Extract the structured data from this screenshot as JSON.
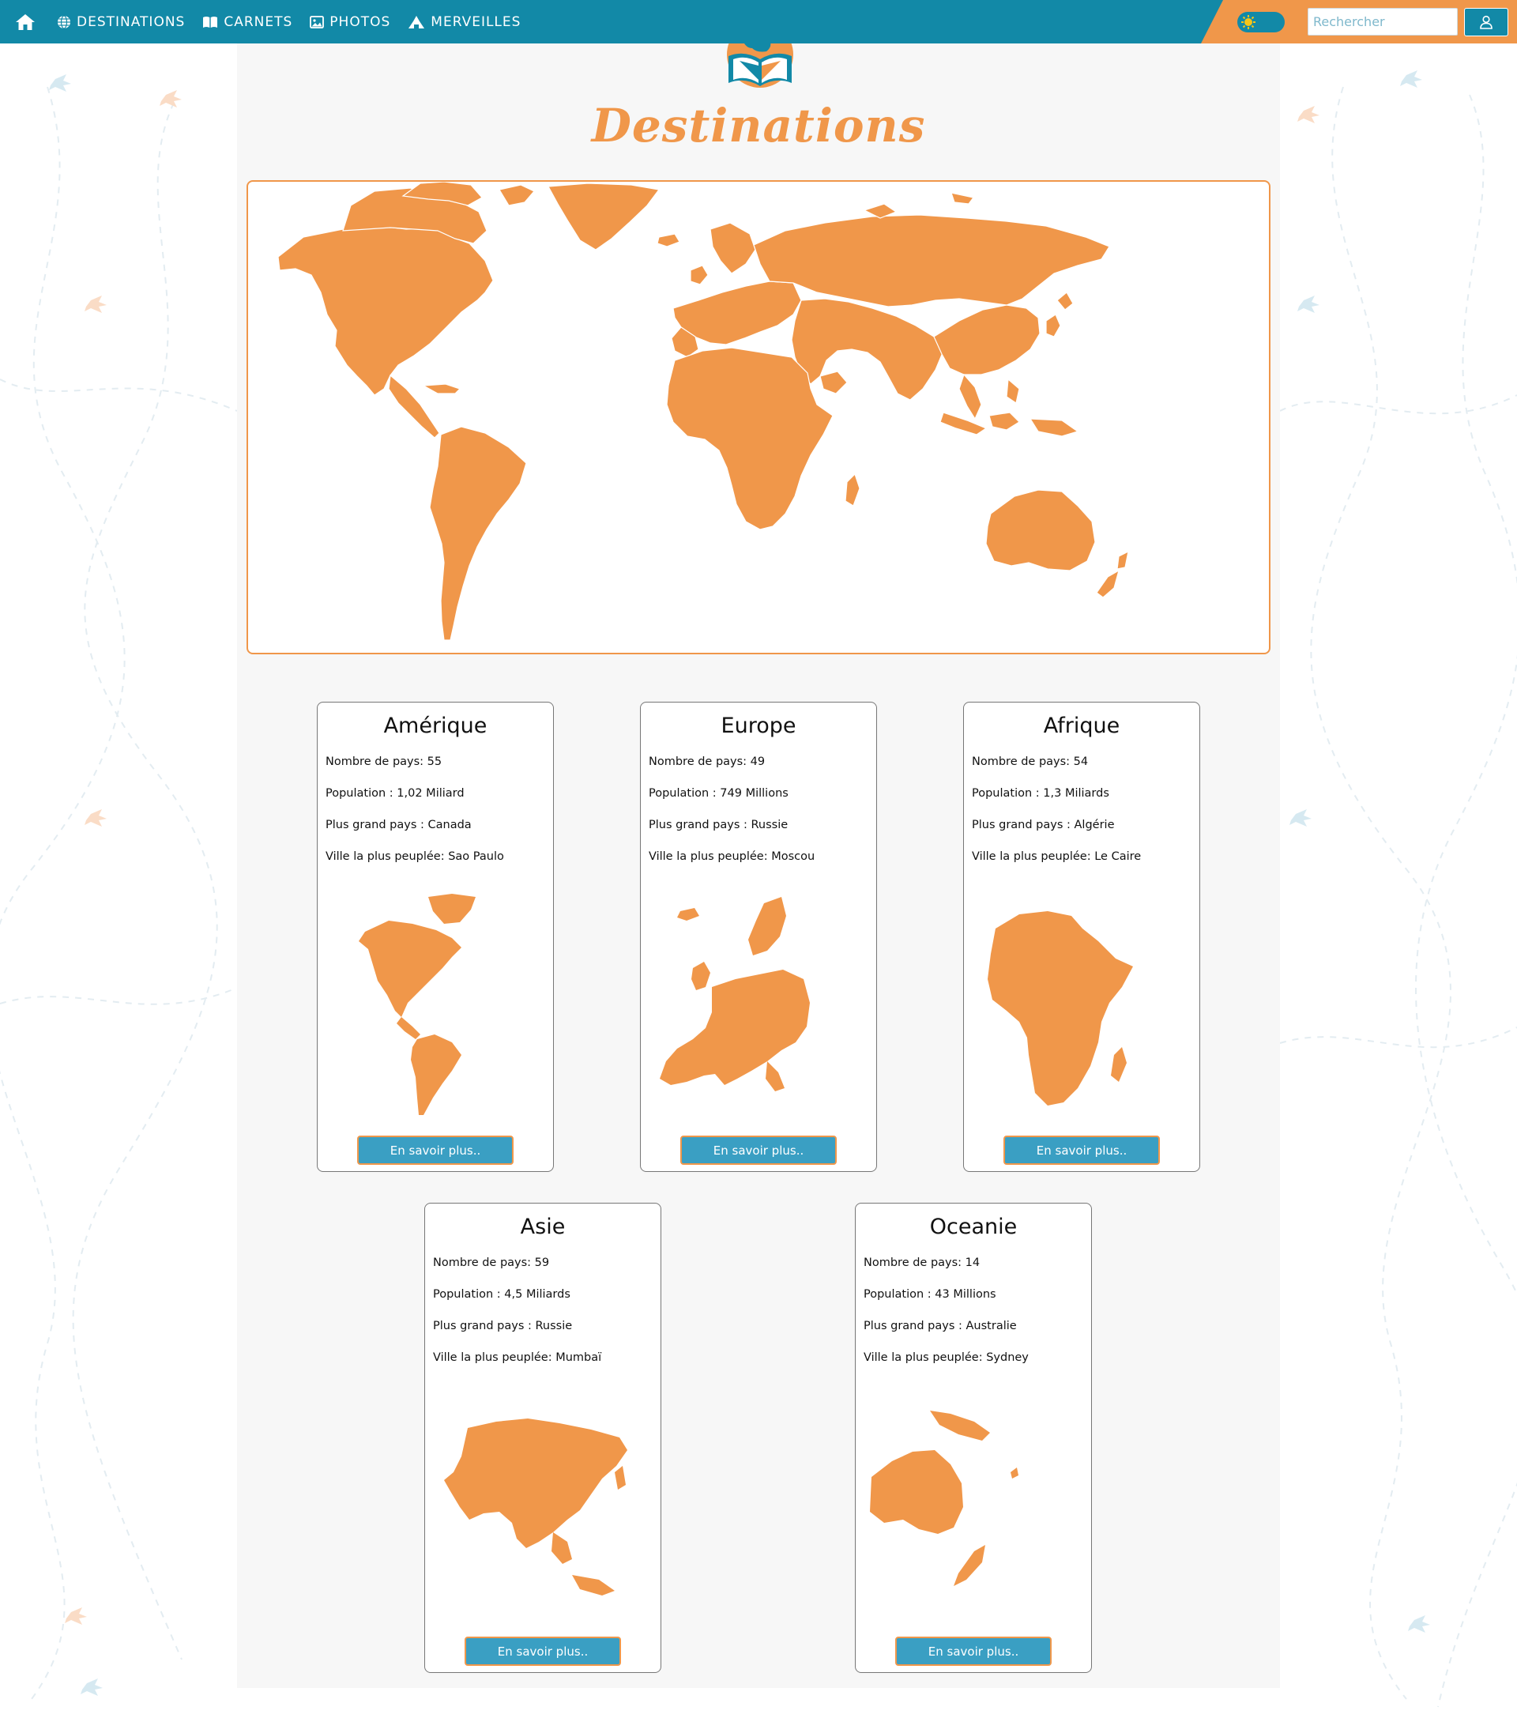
{
  "navbar": {
    "items": [
      {
        "label": "DESTINATIONS",
        "icon": "globe-icon"
      },
      {
        "label": "CARNETS",
        "icon": "book-icon"
      },
      {
        "label": "PHOTOS",
        "icon": "image-icon"
      },
      {
        "label": "MERVEILLES",
        "icon": "monument-icon"
      }
    ],
    "search_placeholder": "Rechercher"
  },
  "page": {
    "title": "Destinations"
  },
  "colors": {
    "primary": "#1289a7",
    "accent": "#f0974a",
    "button": "#3a9fc3"
  },
  "continents": [
    {
      "name": "Amérique",
      "countries": "Nombre de pays: 55",
      "population": "Population : 1,02 Miliard",
      "largest": "Plus grand pays : Canada",
      "city": "Ville la plus peuplée: Sao Paulo",
      "button": "En savoir plus.."
    },
    {
      "name": "Europe",
      "countries": "Nombre de pays: 49",
      "population": "Population : 749 Millions",
      "largest": "Plus grand pays : Russie",
      "city": "Ville la plus peuplée: Moscou",
      "button": "En savoir plus.."
    },
    {
      "name": "Afrique",
      "countries": "Nombre de pays: 54",
      "population": "Population : 1,3 Miliards",
      "largest": "Plus grand pays : Algérie",
      "city": "Ville la plus peuplée: Le Caire",
      "button": "En savoir plus.."
    },
    {
      "name": "Asie",
      "countries": "Nombre de pays: 59",
      "population": "Population : 4,5 Miliards",
      "largest": "Plus grand pays : Russie",
      "city": "Ville la plus peuplée: Mumbaï",
      "button": "En savoir plus.."
    },
    {
      "name": "Oceanie",
      "countries": "Nombre de pays: 14",
      "population": "Population : 43 Millions",
      "largest": "Plus grand pays : Australie",
      "city": "Ville la plus peuplée: Sydney",
      "button": "En savoir plus.."
    }
  ]
}
